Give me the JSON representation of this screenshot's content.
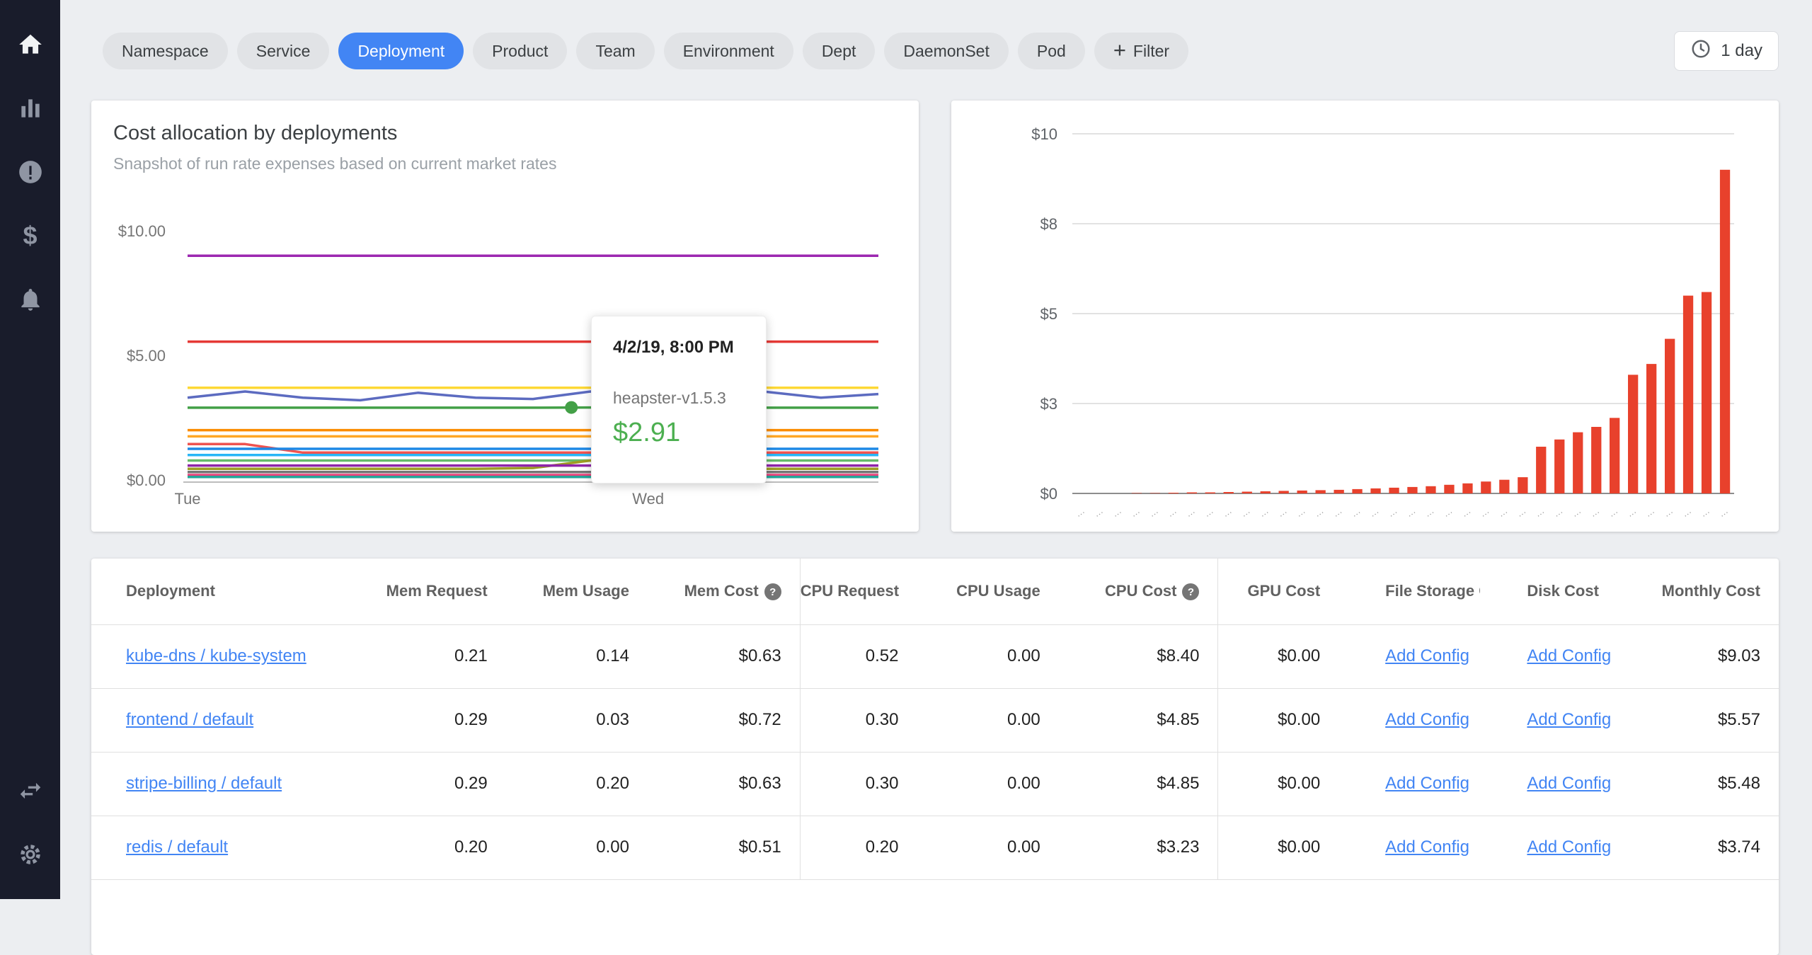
{
  "colors": {
    "accent_blue": "#4285f4",
    "link_blue": "#4285f4",
    "bar_red": "#e8412c",
    "tooltip_green": "#4caf50"
  },
  "sidebar": {
    "top": [
      {
        "name": "nav-home",
        "icon": "home-icon",
        "active": true
      },
      {
        "name": "nav-reports",
        "icon": "bar-chart-icon",
        "active": false
      },
      {
        "name": "nav-alerts",
        "icon": "alert-circle-icon",
        "active": false
      },
      {
        "name": "nav-savings",
        "icon": "dollar-icon",
        "active": false
      },
      {
        "name": "nav-notifications",
        "icon": "bell-icon",
        "active": false
      }
    ],
    "bottom": [
      {
        "name": "nav-switch-context",
        "icon": "swap-arrows-icon",
        "active": false
      },
      {
        "name": "nav-settings",
        "icon": "gear-icon",
        "active": false
      }
    ]
  },
  "topbar": {
    "filters": [
      {
        "label": "Namespace",
        "active": false
      },
      {
        "label": "Service",
        "active": false
      },
      {
        "label": "Deployment",
        "active": true
      },
      {
        "label": "Product",
        "active": false
      },
      {
        "label": "Team",
        "active": false
      },
      {
        "label": "Environment",
        "active": false
      },
      {
        "label": "Dept",
        "active": false
      },
      {
        "label": "DaemonSet",
        "active": false
      },
      {
        "label": "Pod",
        "active": false
      }
    ],
    "add_filter_label": "Filter",
    "time_range": "1 day"
  },
  "chart_data": [
    {
      "type": "line",
      "title": "Cost allocation by deployments",
      "subtitle": "Snapshot of run rate expenses based on current market rates",
      "ylim": [
        0,
        10
      ],
      "y_ticks": [
        {
          "label": "$10.00",
          "value": 10
        },
        {
          "label": "$5.00",
          "value": 5
        },
        {
          "label": "$0.00",
          "value": 0
        }
      ],
      "x_ticks": [
        {
          "label": "Tue",
          "hour": 0
        },
        {
          "label": "Wed",
          "hour": 24
        }
      ],
      "x_domain_hours": 36,
      "series": [
        {
          "color": "#9c27b0",
          "values": [
            9.0,
            9.0,
            9.0,
            9.0,
            9.0,
            9.0,
            9.0,
            9.0,
            9.0,
            9.0,
            9.0,
            9.0,
            9.0
          ]
        },
        {
          "color": "#e53935",
          "values": [
            5.55,
            5.55,
            5.55,
            5.55,
            5.55,
            5.55,
            5.55,
            5.55,
            5.55,
            5.55,
            5.55,
            5.55,
            5.55
          ]
        },
        {
          "color": "#fdd835",
          "values": [
            3.7,
            3.7,
            3.7,
            3.7,
            3.7,
            3.7,
            3.7,
            3.7,
            3.7,
            3.7,
            3.7,
            3.7,
            3.7
          ]
        },
        {
          "color": "#5c6bc0",
          "values": [
            3.3,
            3.55,
            3.3,
            3.2,
            3.5,
            3.3,
            3.25,
            3.55,
            3.35,
            3.3,
            3.55,
            3.3,
            3.45
          ]
        },
        {
          "name": "heapster-v1.5.3",
          "color": "#43a047",
          "values": [
            2.9,
            2.9,
            2.9,
            2.9,
            2.9,
            2.9,
            2.9,
            2.91,
            2.9,
            2.9,
            2.9,
            2.9,
            2.9
          ]
        },
        {
          "color": "#fb8c00",
          "values": [
            2.0,
            2.0,
            2.0,
            2.0,
            2.0,
            2.0,
            2.0,
            2.0,
            2.0,
            2.0,
            2.0,
            2.0,
            2.0
          ]
        },
        {
          "color": "#ffa726",
          "values": [
            1.75,
            1.75,
            1.75,
            1.75,
            1.75,
            1.75,
            1.75,
            1.75,
            1.75,
            1.75,
            1.75,
            1.75,
            1.75
          ]
        },
        {
          "color": "#ef5350",
          "values": [
            1.44,
            1.44,
            1.1,
            1.1,
            1.1,
            1.1,
            1.1,
            1.1,
            1.1,
            1.1,
            1.1,
            1.1,
            1.1
          ]
        },
        {
          "color": "#1e88e5",
          "values": [
            1.25,
            1.25,
            1.25,
            1.25,
            1.25,
            1.25,
            1.25,
            1.25,
            1.25,
            1.25,
            1.25,
            1.25,
            1.25
          ]
        },
        {
          "color": "#29b6f6",
          "values": [
            1.0,
            1.0,
            1.0,
            1.0,
            1.0,
            1.0,
            1.0,
            1.0,
            1.0,
            1.0,
            1.0,
            1.0,
            1.0
          ]
        },
        {
          "color": "#66bb6a",
          "values": [
            0.78,
            0.78,
            0.78,
            0.78,
            0.78,
            0.78,
            0.78,
            0.78,
            0.78,
            0.78,
            0.78,
            0.78,
            0.78
          ]
        },
        {
          "color": "#9e9d24",
          "values": [
            0.45,
            0.45,
            0.45,
            0.45,
            0.45,
            0.45,
            0.48,
            0.78,
            0.55,
            0.45,
            0.45,
            0.45,
            0.45
          ]
        },
        {
          "color": "#8e24aa",
          "values": [
            0.58,
            0.58,
            0.58,
            0.58,
            0.58,
            0.58,
            0.58,
            0.58,
            0.58,
            0.58,
            0.58,
            0.58,
            0.58
          ]
        },
        {
          "color": "#757575",
          "values": [
            0.32,
            0.32,
            0.32,
            0.32,
            0.32,
            0.32,
            0.32,
            0.32,
            0.32,
            0.32,
            0.32,
            0.32,
            0.32
          ]
        },
        {
          "color": "#ec407a",
          "values": [
            0.2,
            0.2,
            0.2,
            0.2,
            0.2,
            0.2,
            0.2,
            0.2,
            0.2,
            0.2,
            0.2,
            0.2,
            0.2
          ]
        },
        {
          "color": "#26a69a",
          "values": [
            0.12,
            0.12,
            0.12,
            0.12,
            0.12,
            0.12,
            0.12,
            0.12,
            0.12,
            0.12,
            0.12,
            0.12,
            0.12
          ]
        }
      ],
      "tooltip": {
        "datetime": "4/2/19, 8:00 PM",
        "series": "heapster-v1.5.3",
        "value": "$2.91",
        "marker_hour": 20,
        "marker_value": 2.91,
        "marker_color": "#43a047"
      }
    },
    {
      "type": "bar",
      "ylim": [
        0,
        10
      ],
      "y_ticks": [
        {
          "label": "$10",
          "value": 10
        },
        {
          "label": "$8",
          "value": 7.5
        },
        {
          "label": "$5",
          "value": 5
        },
        {
          "label": "$3",
          "value": 2.5
        },
        {
          "label": "$0",
          "value": 0
        }
      ],
      "bar_color": "#e8412c",
      "values": [
        0,
        0,
        0,
        0.01,
        0.01,
        0.02,
        0.03,
        0.03,
        0.04,
        0.05,
        0.06,
        0.07,
        0.08,
        0.09,
        0.1,
        0.12,
        0.14,
        0.16,
        0.18,
        0.2,
        0.24,
        0.28,
        0.33,
        0.38,
        0.45,
        1.3,
        1.5,
        1.7,
        1.85,
        2.1,
        3.3,
        3.6,
        4.3,
        5.5,
        5.6,
        9.0
      ],
      "x_tick_label": "…"
    }
  ],
  "table": {
    "add_config_label": "Add Config",
    "columns": [
      {
        "label": "Deployment",
        "align": "left"
      },
      {
        "label": "Mem Request",
        "align": "right"
      },
      {
        "label": "Mem Usage",
        "align": "right"
      },
      {
        "label": "Mem Cost",
        "align": "right",
        "help": true
      },
      {
        "label": "CPU Request",
        "align": "right",
        "group_start": true
      },
      {
        "label": "CPU Usage",
        "align": "right"
      },
      {
        "label": "CPU Cost",
        "align": "right",
        "help": true
      },
      {
        "label": "GPU Cost",
        "align": "right",
        "group_start": true
      },
      {
        "label": "File Storage Co",
        "align": "left"
      },
      {
        "label": "Disk Cost",
        "align": "left"
      },
      {
        "label": "Monthly Cost",
        "align": "right"
      }
    ],
    "rows": [
      {
        "deployment": "kube-dns / kube-system",
        "cells": [
          "0.21",
          "0.14",
          "$0.63",
          "0.52",
          "0.00",
          "$8.40",
          "$0.00",
          "Add Config",
          "Add Config",
          "$9.03"
        ]
      },
      {
        "deployment": "frontend / default",
        "cells": [
          "0.29",
          "0.03",
          "$0.72",
          "0.30",
          "0.00",
          "$4.85",
          "$0.00",
          "Add Config",
          "Add Config",
          "$5.57"
        ]
      },
      {
        "deployment": "stripe-billing / default",
        "cells": [
          "0.29",
          "0.20",
          "$0.63",
          "0.30",
          "0.00",
          "$4.85",
          "$0.00",
          "Add Config",
          "Add Config",
          "$5.48"
        ]
      },
      {
        "deployment": "redis / default",
        "cells": [
          "0.20",
          "0.00",
          "$0.51",
          "0.20",
          "0.00",
          "$3.23",
          "$0.00",
          "Add Config",
          "Add Config",
          "$3.74"
        ]
      }
    ]
  }
}
